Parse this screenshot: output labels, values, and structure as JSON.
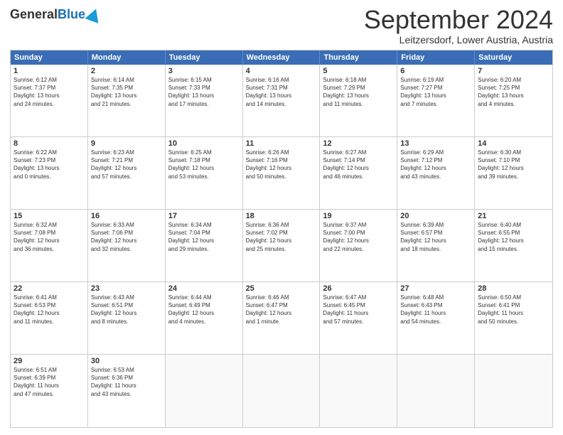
{
  "header": {
    "logo_general": "General",
    "logo_blue": "Blue",
    "title": "September 2024",
    "subtitle": "Leitzersdorf, Lower Austria, Austria"
  },
  "calendar": {
    "days": [
      "Sunday",
      "Monday",
      "Tuesday",
      "Wednesday",
      "Thursday",
      "Friday",
      "Saturday"
    ],
    "weeks": [
      [
        {
          "num": "",
          "empty": true,
          "info": ""
        },
        {
          "num": "2",
          "info": "Sunrise: 6:14 AM\nSunset: 7:35 PM\nDaylight: 13 hours\nand 21 minutes."
        },
        {
          "num": "3",
          "info": "Sunrise: 6:15 AM\nSunset: 7:33 PM\nDaylight: 13 hours\nand 17 minutes."
        },
        {
          "num": "4",
          "info": "Sunrise: 6:16 AM\nSunset: 7:31 PM\nDaylight: 13 hours\nand 14 minutes."
        },
        {
          "num": "5",
          "info": "Sunrise: 6:18 AM\nSunset: 7:29 PM\nDaylight: 13 hours\nand 11 minutes."
        },
        {
          "num": "6",
          "info": "Sunrise: 6:19 AM\nSunset: 7:27 PM\nDaylight: 13 hours\nand 7 minutes."
        },
        {
          "num": "7",
          "info": "Sunrise: 6:20 AM\nSunset: 7:25 PM\nDaylight: 13 hours\nand 4 minutes."
        }
      ],
      [
        {
          "num": "8",
          "info": "Sunrise: 6:22 AM\nSunset: 7:23 PM\nDaylight: 13 hours\nand 0 minutes."
        },
        {
          "num": "9",
          "info": "Sunrise: 6:23 AM\nSunset: 7:21 PM\nDaylight: 12 hours\nand 57 minutes."
        },
        {
          "num": "10",
          "info": "Sunrise: 6:25 AM\nSunset: 7:18 PM\nDaylight: 12 hours\nand 53 minutes."
        },
        {
          "num": "11",
          "info": "Sunrise: 6:26 AM\nSunset: 7:16 PM\nDaylight: 12 hours\nand 50 minutes."
        },
        {
          "num": "12",
          "info": "Sunrise: 6:27 AM\nSunset: 7:14 PM\nDaylight: 12 hours\nand 46 minutes."
        },
        {
          "num": "13",
          "info": "Sunrise: 6:29 AM\nSunset: 7:12 PM\nDaylight: 12 hours\nand 43 minutes."
        },
        {
          "num": "14",
          "info": "Sunrise: 6:30 AM\nSunset: 7:10 PM\nDaylight: 12 hours\nand 39 minutes."
        }
      ],
      [
        {
          "num": "15",
          "info": "Sunrise: 6:32 AM\nSunset: 7:08 PM\nDaylight: 12 hours\nand 36 minutes."
        },
        {
          "num": "16",
          "info": "Sunrise: 6:33 AM\nSunset: 7:06 PM\nDaylight: 12 hours\nand 32 minutes."
        },
        {
          "num": "17",
          "info": "Sunrise: 6:34 AM\nSunset: 7:04 PM\nDaylight: 12 hours\nand 29 minutes."
        },
        {
          "num": "18",
          "info": "Sunrise: 6:36 AM\nSunset: 7:02 PM\nDaylight: 12 hours\nand 25 minutes."
        },
        {
          "num": "19",
          "info": "Sunrise: 6:37 AM\nSunset: 7:00 PM\nDaylight: 12 hours\nand 22 minutes."
        },
        {
          "num": "20",
          "info": "Sunrise: 6:39 AM\nSunset: 6:57 PM\nDaylight: 12 hours\nand 18 minutes."
        },
        {
          "num": "21",
          "info": "Sunrise: 6:40 AM\nSunset: 6:55 PM\nDaylight: 12 hours\nand 15 minutes."
        }
      ],
      [
        {
          "num": "22",
          "info": "Sunrise: 6:41 AM\nSunset: 6:53 PM\nDaylight: 12 hours\nand 11 minutes."
        },
        {
          "num": "23",
          "info": "Sunrise: 6:43 AM\nSunset: 6:51 PM\nDaylight: 12 hours\nand 8 minutes."
        },
        {
          "num": "24",
          "info": "Sunrise: 6:44 AM\nSunset: 6:49 PM\nDaylight: 12 hours\nand 4 minutes."
        },
        {
          "num": "25",
          "info": "Sunrise: 6:46 AM\nSunset: 6:47 PM\nDaylight: 12 hours\nand 1 minute."
        },
        {
          "num": "26",
          "info": "Sunrise: 6:47 AM\nSunset: 6:45 PM\nDaylight: 11 hours\nand 57 minutes."
        },
        {
          "num": "27",
          "info": "Sunrise: 6:48 AM\nSunset: 6:43 PM\nDaylight: 11 hours\nand 54 minutes."
        },
        {
          "num": "28",
          "info": "Sunrise: 6:50 AM\nSunset: 6:41 PM\nDaylight: 11 hours\nand 50 minutes."
        }
      ],
      [
        {
          "num": "29",
          "info": "Sunrise: 6:51 AM\nSunset: 6:39 PM\nDaylight: 11 hours\nand 47 minutes."
        },
        {
          "num": "30",
          "info": "Sunrise: 6:53 AM\nSunset: 6:36 PM\nDaylight: 11 hours\nand 43 minutes."
        },
        {
          "num": "",
          "empty": true,
          "info": ""
        },
        {
          "num": "",
          "empty": true,
          "info": ""
        },
        {
          "num": "",
          "empty": true,
          "info": ""
        },
        {
          "num": "",
          "empty": true,
          "info": ""
        },
        {
          "num": "",
          "empty": true,
          "info": ""
        }
      ]
    ]
  }
}
